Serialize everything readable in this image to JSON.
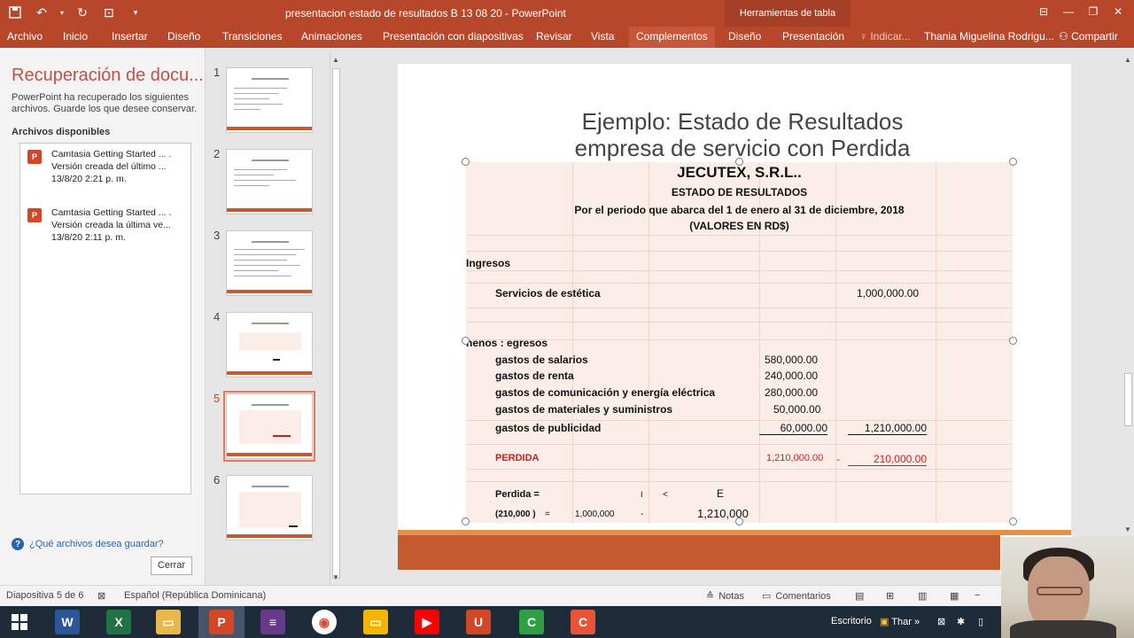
{
  "titlebar": {
    "doc_title": "presentacion estado de resultados    B 13 08 20 - PowerPoint",
    "tools_label": "Herramientas de tabla"
  },
  "ribbon": {
    "tabs": [
      "Archivo",
      "Inicio",
      "Insertar",
      "Diseño",
      "Transiciones",
      "Animaciones",
      "Presentación con diapositivas",
      "Revisar",
      "Vista",
      "Complementos",
      "Diseño",
      "Presentación"
    ],
    "tell_me": "Indicar...",
    "user": "Thania Miguelina Rodrigu...",
    "share": "Compartir"
  },
  "recovery": {
    "title": "Recuperación de docu...",
    "description": "PowerPoint ha recuperado los siguientes archivos. Guarde los que desee conservar.",
    "available": "Archivos disponibles",
    "items": [
      {
        "name": "Camtasia Getting Started ... .",
        "version": "Versión creada del último ...",
        "date": "13/8/20 2:21 p. m."
      },
      {
        "name": "Camtasia Getting Started ... .",
        "version": "Versión creada la última ve...",
        "date": "13/8/20 2:11 p. m."
      }
    ],
    "help": "¿Qué archivos desea guardar?",
    "close": "Cerrar"
  },
  "thumbnails": {
    "numbers": [
      "1",
      "2",
      "3",
      "4",
      "5",
      "6"
    ],
    "active": 5
  },
  "slide": {
    "title_line1": "Ejemplo: Estado de Resultados",
    "title_line2": "empresa de servicio  con Perdida",
    "company": "JECUTEX, S.R.L..",
    "statement": "ESTADO DE RESULTADOS",
    "period": "Por el periodo que abarca  del 1 de enero al 31 de diciembre, 2018",
    "currency": "(VALORES EN RD$)",
    "income_label": "Ingresos",
    "income_item": "Servicios de estética",
    "income_value": "1,000,000.00",
    "expenses_label": "nenos : egresos",
    "expenses": [
      {
        "label": "gastos de salarios",
        "value": "580,000.00"
      },
      {
        "label": "gastos de renta",
        "value": "240,000.00"
      },
      {
        "label": "gastos de comunicación y energía eléctrica",
        "value": "280,000.00"
      },
      {
        "label": "gastos de materiales y suministros",
        "value": "50,000.00"
      },
      {
        "label": "gastos de publicidad",
        "value": "60,000.00"
      }
    ],
    "expenses_total": "1,210,000.00",
    "loss_label": "PERDIDA",
    "loss_total": "1,210,000.00",
    "loss_minus": "-",
    "loss_value": "210,000.00",
    "formula_label": "Perdida =",
    "formula_i": "I",
    "formula_lt": "<",
    "formula_e": "E",
    "calc_loss": "(210,000 )",
    "calc_eq": "=",
    "calc_income": "1,000,000",
    "calc_minus": "-",
    "calc_expenses": "1,210,000"
  },
  "status": {
    "slide_info": "Diapositiva 5 de 6",
    "language": "Español (República Dominicana)",
    "notes": "Notas",
    "comments": "Comentarios"
  },
  "taskbar": {
    "desktop": "Escritorio",
    "user_short": "Thar"
  },
  "colors": {
    "accent": "#b7472a",
    "loss": "#d01c1c",
    "table_fill": "#fbeee8"
  }
}
